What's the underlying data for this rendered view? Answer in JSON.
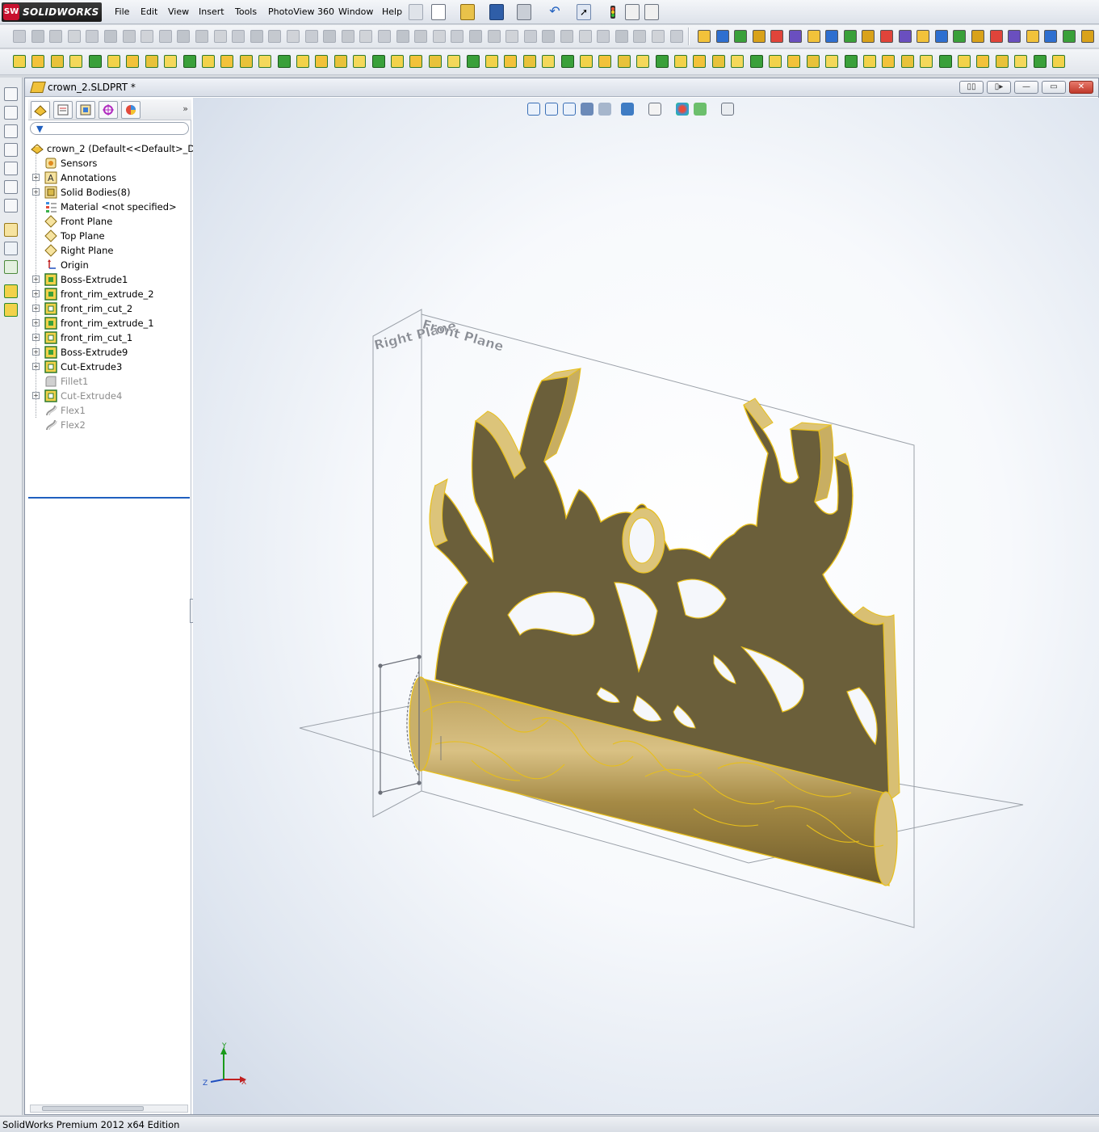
{
  "app": {
    "logo_badge": "SW",
    "brand": "SOLIDWORKS",
    "menu": [
      "File",
      "Edit",
      "View",
      "Insert",
      "Tools",
      "PhotoView 360",
      "Window",
      "Help"
    ]
  },
  "document": {
    "title": "crown_2.SLDPRT *",
    "window_buttons": [
      "restore-tile",
      "tile",
      "minimize",
      "maximize",
      "close"
    ]
  },
  "feature_manager": {
    "tabs": [
      "featuremanager-tree",
      "propertymanager",
      "configurationmanager",
      "dimxpertmanager",
      "display-manager"
    ],
    "root": "crown_2  (Default<<Default>_Dis",
    "items": [
      {
        "label": "Sensors",
        "icon": "sensor-icon",
        "expandable": false,
        "dim": false
      },
      {
        "label": "Annotations",
        "icon": "annotations-icon",
        "expandable": true,
        "dim": false
      },
      {
        "label": "Solid Bodies(8)",
        "icon": "solid-bodies-icon",
        "expandable": true,
        "dim": false
      },
      {
        "label": "Material <not specified>",
        "icon": "material-icon",
        "expandable": false,
        "dim": false
      },
      {
        "label": "Front Plane",
        "icon": "plane-icon",
        "expandable": false,
        "dim": false
      },
      {
        "label": "Top Plane",
        "icon": "plane-icon",
        "expandable": false,
        "dim": false
      },
      {
        "label": "Right Plane",
        "icon": "plane-icon",
        "expandable": false,
        "dim": false
      },
      {
        "label": "Origin",
        "icon": "origin-icon",
        "expandable": false,
        "dim": false
      },
      {
        "label": "Boss-Extrude1",
        "icon": "boss-extrude-icon",
        "expandable": true,
        "dim": false
      },
      {
        "label": "front_rim_extrude_2",
        "icon": "boss-extrude-icon",
        "expandable": true,
        "dim": false
      },
      {
        "label": "front_rim_cut_2",
        "icon": "cut-extrude-icon",
        "expandable": true,
        "dim": false
      },
      {
        "label": "front_rim_extrude_1",
        "icon": "boss-extrude-icon",
        "expandable": true,
        "dim": false
      },
      {
        "label": "front_rim_cut_1",
        "icon": "cut-extrude-icon",
        "expandable": true,
        "dim": false
      },
      {
        "label": "Boss-Extrude9",
        "icon": "boss-extrude-icon",
        "expandable": true,
        "dim": false
      },
      {
        "label": "Cut-Extrude3",
        "icon": "cut-extrude-icon",
        "expandable": true,
        "dim": false
      },
      {
        "label": "Fillet1",
        "icon": "fillet-icon",
        "expandable": false,
        "dim": true
      },
      {
        "label": "Cut-Extrude4",
        "icon": "cut-extrude-icon",
        "expandable": true,
        "dim": true
      },
      {
        "label": "Flex1",
        "icon": "flex-icon",
        "expandable": false,
        "dim": true
      },
      {
        "label": "Flex2",
        "icon": "flex-icon",
        "expandable": false,
        "dim": true
      }
    ]
  },
  "viewport": {
    "plane_label_right": "Right Plane",
    "plane_label_front": "Front Plane",
    "model_color": "#6b5f3a",
    "edge_color": "#f2c200",
    "triad": {
      "x": "X",
      "y": "Y",
      "z": "Z"
    }
  },
  "status": {
    "text": "SolidWorks Premium 2012 x64 Edition"
  }
}
